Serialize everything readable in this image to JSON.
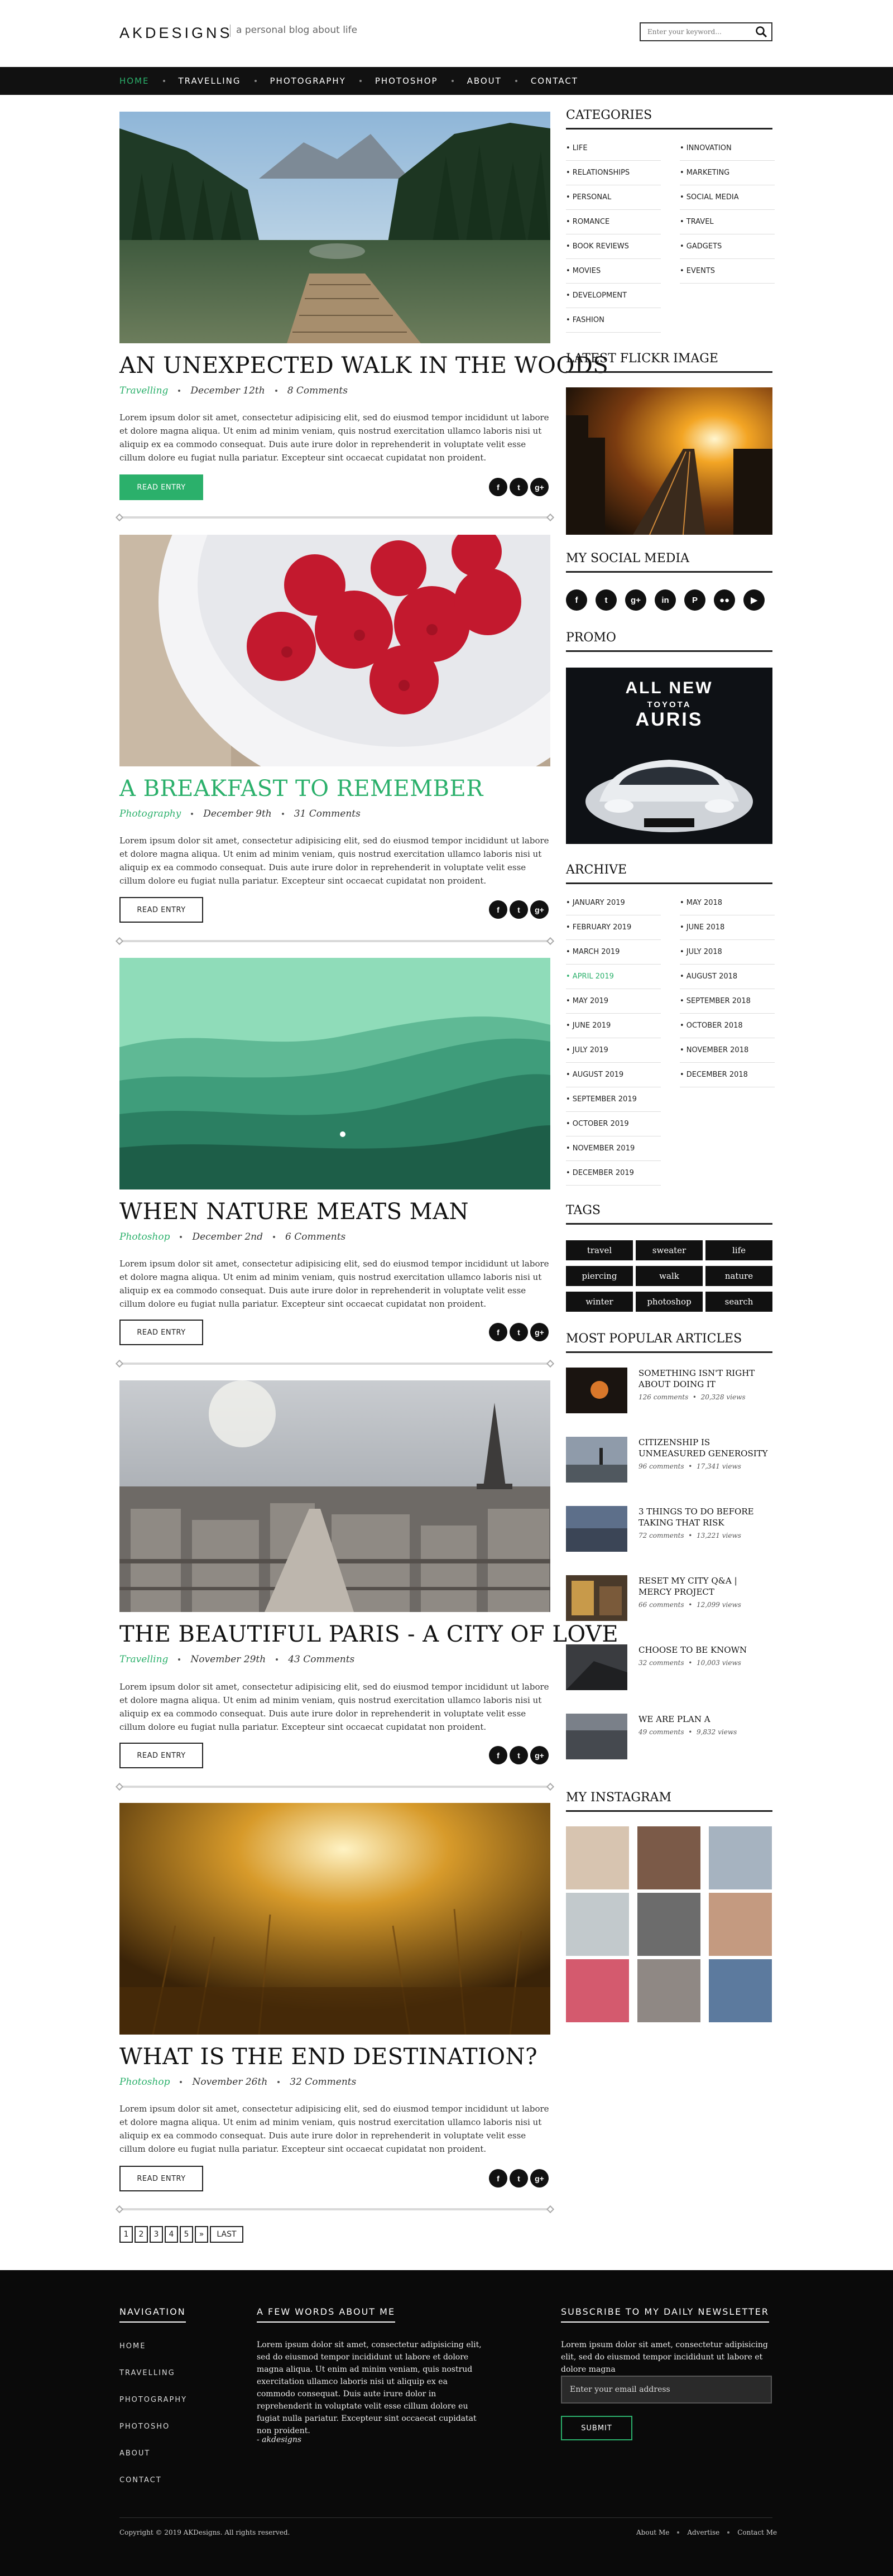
{
  "header": {
    "logo": "AKDESIGNS",
    "tagline": "a personal blog about life",
    "search_placeholder": "Enter your keyword..."
  },
  "nav": {
    "items": [
      "HOME",
      "TRAVELLING",
      "PHOTOGRAPHY",
      "PHOTOSHOP",
      "ABOUT",
      "CONTACT"
    ],
    "active": "HOME"
  },
  "posts": [
    {
      "title": "AN UNEXPECTED WALK IN THE WOODS",
      "category": "Travelling",
      "date": "December 12th",
      "comments": "8 Comments",
      "button": "READ ENTRY",
      "button_active": true
    },
    {
      "title": "A BREAKFAST TO REMEMBER",
      "category": "Photography",
      "date": "December 9th",
      "comments": "31 Comments",
      "button": "READ ENTRY",
      "title_hover": true
    },
    {
      "title": "WHEN NATURE MEATS MAN",
      "category": "Photoshop",
      "date": "December 2nd",
      "comments": "6 Comments",
      "button": "READ ENTRY"
    },
    {
      "title": "THE BEAUTIFUL PARIS - A CITY OF LOVE",
      "category": "Travelling",
      "date": "November 29th",
      "comments": "43 Comments",
      "button": "READ ENTRY"
    },
    {
      "title": "WHAT IS THE END DESTINATION?",
      "category": "Photoshop",
      "date": "November 26th",
      "comments": "32 Comments",
      "button": "READ ENTRY"
    }
  ],
  "excerpt": "Lorem ipsum dolor sit amet, consectetur adipisicing elit, sed do eiusmod tempor incididunt ut labore et dolore magna aliqua. Ut enim ad minim veniam, quis nostrud exercitation ullamco laboris nisi ut aliquip ex ea commodo consequat. Duis aute irure dolor in reprehenderit in voluptate velit esse cillum dolore eu fugiat nulla pariatur. Excepteur sint occaecat cupidatat non proident.",
  "share_icons": [
    "facebook-icon",
    "twitter-icon",
    "googleplus-icon"
  ],
  "pagination": [
    "1",
    "2",
    "3",
    "4",
    "5",
    "»",
    "LAST"
  ],
  "sidebar": {
    "categories_title": "CATEGORIES",
    "categories_left": [
      "• LIFE",
      "• RELATIONSHIPS",
      "• PERSONAL",
      "• ROMANCE",
      "• BOOK REVIEWS",
      "• MOVIES",
      "• DEVELOPMENT",
      "• FASHION"
    ],
    "categories_right": [
      "• INNOVATION",
      "• MARKETING",
      "• SOCIAL MEDIA",
      "• TRAVEL",
      "• GADGETS",
      "• EVENTS"
    ],
    "flickr_title": "LATEST FLICKR IMAGE",
    "social_title": "MY SOCIAL MEDIA",
    "social_icons": [
      "facebook-icon",
      "twitter-icon",
      "googleplus-icon",
      "linkedin-icon",
      "pinterest-icon",
      "flickr-icon",
      "youtube-icon"
    ],
    "promo_title": "PROMO",
    "promo": {
      "line1": "ALL NEW",
      "line2": "TOYOTA",
      "line3": "AURIS"
    },
    "archive_title": "ARCHIVE",
    "archive_left": [
      "• JANUARY 2019",
      "• FEBRUARY 2019",
      "• MARCH 2019",
      "• APRIL 2019",
      "• MAY 2019",
      "• JUNE 2019",
      "• JULY 2019",
      "• AUGUST 2019",
      "• SEPTEMBER 2019",
      "• OCTOBER 2019",
      "• NOVEMBER 2019",
      "• DECEMBER 2019"
    ],
    "archive_right": [
      "• MAY 2018",
      "• JUNE 2018",
      "• JULY 2018",
      "• AUGUST 2018",
      "• SEPTEMBER 2018",
      "• OCTOBER 2018",
      "• NOVEMBER 2018",
      "• DECEMBER 2018"
    ],
    "archive_hover": "• APRIL 2019",
    "tags_title": "TAGS",
    "tags": [
      "travel",
      "sweater",
      "life",
      "piercing",
      "walk",
      "nature",
      "winter",
      "photoshop",
      "search"
    ],
    "popular_title": "MOST POPULAR ARTICLES",
    "popular": [
      {
        "title": "SOMETHING ISN'T RIGHT ABOUT DOING IT",
        "comments": "126 comments",
        "views": "20,328 views"
      },
      {
        "title": "CITIZENSHIP IS UNMEASURED GENEROSITY",
        "comments": "96 comments",
        "views": "17,341 views"
      },
      {
        "title": "3 THINGS TO DO BEFORE TAKING THAT RISK",
        "comments": "72 comments",
        "views": "13,221 views"
      },
      {
        "title": "RESET MY CITY Q&A | MERCY PROJECT",
        "comments": "66 comments",
        "views": "12,099 views"
      },
      {
        "title": "CHOOSE TO BE KNOWN",
        "comments": "32 comments",
        "views": "10,003 views"
      },
      {
        "title": "WE ARE PLAN A",
        "comments": "49 comments",
        "views": "9,832 views"
      }
    ],
    "instagram_title": "MY INSTAGRAM"
  },
  "footer": {
    "nav_title": "NAVIGATION",
    "nav_items": [
      "HOME",
      "TRAVELLING",
      "PHOTOGRAPHY",
      "PHOTOSHO",
      "ABOUT",
      "CONTACT"
    ],
    "about_title": "A FEW WORDS ABOUT ME",
    "about_text": "Lorem ipsum dolor sit amet, consectetur adipisicing elit, sed do eiusmod tempor incididunt ut labore et dolore magna aliqua. Ut enim ad minim veniam, quis nostrud exercitation ullamco laboris nisi ut aliquip ex ea commodo consequat. Duis aute irure dolor in reprehenderit in voluptate velit esse cillum dolore eu fugiat nulla pariatur. Excepteur sint occaecat cupidatat non proident.",
    "signature": "- akdesigns",
    "newsletter_title": "SUBSCRIBE TO MY DAILY NEWSLETTER",
    "newsletter_text": "Lorem ipsum dolor sit amet, consectetur adipisicing elit, sed do eiusmod tempor incididunt ut labore et dolore magna",
    "email_placeholder": "Enter your email address",
    "submit": "SUBMIT",
    "copyright": "Copyright © 2019 AKDesigns. All rights reserved.",
    "links": [
      "About Me",
      "Advertise",
      "Contact Me"
    ]
  },
  "colors": {
    "accent": "#2bb06b",
    "nav_bg": "#111111",
    "footer_bg": "#0a0a0a"
  }
}
